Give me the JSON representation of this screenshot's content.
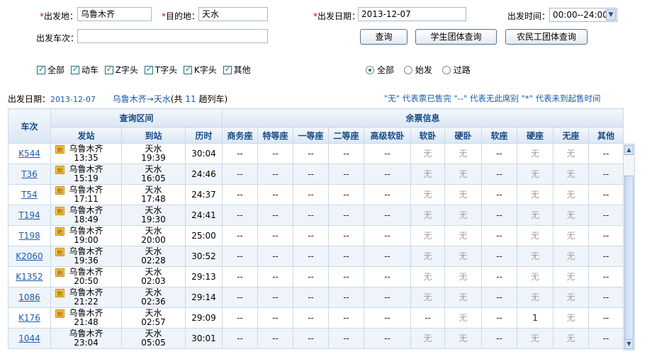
{
  "form": {
    "from_label": "出发地：",
    "from_value": "乌鲁木齐",
    "to_label": "目的地：",
    "to_value": "天水",
    "date_label": "出发日期：",
    "date_value": "2013-12-07",
    "time_label": "出发时间：",
    "time_value": "00:00--24:00",
    "train_no_label": "出发车次：",
    "train_no_value": "",
    "req_mark": "*"
  },
  "buttons": {
    "query": "查询",
    "student": "学生团体查询",
    "migrant": "农民工团体查询"
  },
  "filters": [
    "全部",
    "动车",
    "Z字头",
    "T字头",
    "K字头",
    "其他"
  ],
  "radios": [
    "全部",
    "始发",
    "过路"
  ],
  "summary": {
    "date_label": "出发日期：",
    "date_value": "2013-12-07",
    "route": "乌鲁木齐→天水",
    "count_prefix": "(共 ",
    "count": "11",
    "count_suffix": " 趟列车)",
    "legend": "\"无\" 代表票已售完  \"--\" 代表无此席别  \"*\" 代表未到起售时间"
  },
  "table": {
    "header_train": "车次",
    "header_interval": "查询区间",
    "header_tickets": "余票信息",
    "col_from": "发站",
    "col_to": "到站",
    "col_duration": "历时",
    "seat_cols": [
      "商务座",
      "特等座",
      "一等座",
      "二等座",
      "高级软卧",
      "软卧",
      "硬卧",
      "软座",
      "硬座",
      "无座",
      "其他"
    ],
    "origin_badge": "始",
    "rows": [
      {
        "train": "K544",
        "from": "乌鲁木齐",
        "dep": "13:35",
        "to": "天水",
        "arr": "19:39",
        "dur": "30:04",
        "origin": true,
        "seats": [
          "--",
          "--",
          "--",
          "--",
          "--",
          "无",
          "无",
          "--",
          "无",
          "无",
          "--"
        ]
      },
      {
        "train": "T36",
        "from": "乌鲁木齐",
        "dep": "15:19",
        "to": "天水",
        "arr": "16:05",
        "dur": "24:46",
        "origin": true,
        "seats": [
          "--",
          "--",
          "--",
          "--",
          "--",
          "无",
          "无",
          "--",
          "无",
          "无",
          "--"
        ]
      },
      {
        "train": "T54",
        "from": "乌鲁木齐",
        "dep": "17:11",
        "to": "天水",
        "arr": "17:48",
        "dur": "24:37",
        "origin": true,
        "seats": [
          "--",
          "--",
          "--",
          "--",
          "--",
          "无",
          "无",
          "--",
          "无",
          "无",
          "--"
        ]
      },
      {
        "train": "T194",
        "from": "乌鲁木齐",
        "dep": "18:49",
        "to": "天水",
        "arr": "19:30",
        "dur": "24:41",
        "origin": true,
        "seats": [
          "--",
          "--",
          "--",
          "--",
          "--",
          "无",
          "无",
          "--",
          "无",
          "无",
          "--"
        ]
      },
      {
        "train": "T198",
        "from": "乌鲁木齐",
        "dep": "19:00",
        "to": "天水",
        "arr": "20:00",
        "dur": "25:00",
        "origin": true,
        "seats": [
          "--",
          "--",
          "--",
          "--",
          "--",
          "无",
          "无",
          "--",
          "无",
          "无",
          "--"
        ]
      },
      {
        "train": "K2060",
        "from": "乌鲁木齐",
        "dep": "19:36",
        "to": "天水",
        "arr": "02:28",
        "dur": "30:52",
        "origin": true,
        "seats": [
          "--",
          "--",
          "--",
          "--",
          "--",
          "无",
          "无",
          "--",
          "无",
          "无",
          "--"
        ]
      },
      {
        "train": "K1352",
        "from": "乌鲁木齐",
        "dep": "20:50",
        "to": "天水",
        "arr": "02:03",
        "dur": "29:13",
        "origin": true,
        "seats": [
          "--",
          "--",
          "--",
          "--",
          "--",
          "无",
          "无",
          "--",
          "无",
          "无",
          "--"
        ]
      },
      {
        "train": "1086",
        "from": "乌鲁木齐",
        "dep": "21:22",
        "to": "天水",
        "arr": "02:36",
        "dur": "29:14",
        "origin": true,
        "seats": [
          "--",
          "--",
          "--",
          "--",
          "--",
          "无",
          "无",
          "--",
          "无",
          "无",
          "--"
        ]
      },
      {
        "train": "K176",
        "from": "乌鲁木齐",
        "dep": "21:48",
        "to": "天水",
        "arr": "02:57",
        "dur": "29:09",
        "origin": true,
        "seats": [
          "--",
          "--",
          "--",
          "--",
          "--",
          "--",
          "无",
          "--",
          "1",
          "无",
          "--"
        ]
      },
      {
        "train": "1044",
        "from": "乌鲁木齐",
        "dep": "23:04",
        "to": "天水",
        "arr": "05:05",
        "dur": "30:01",
        "origin": false,
        "seats": [
          "--",
          "--",
          "--",
          "--",
          "--",
          "无",
          "无",
          "--",
          "无",
          "无",
          "--"
        ]
      }
    ]
  }
}
